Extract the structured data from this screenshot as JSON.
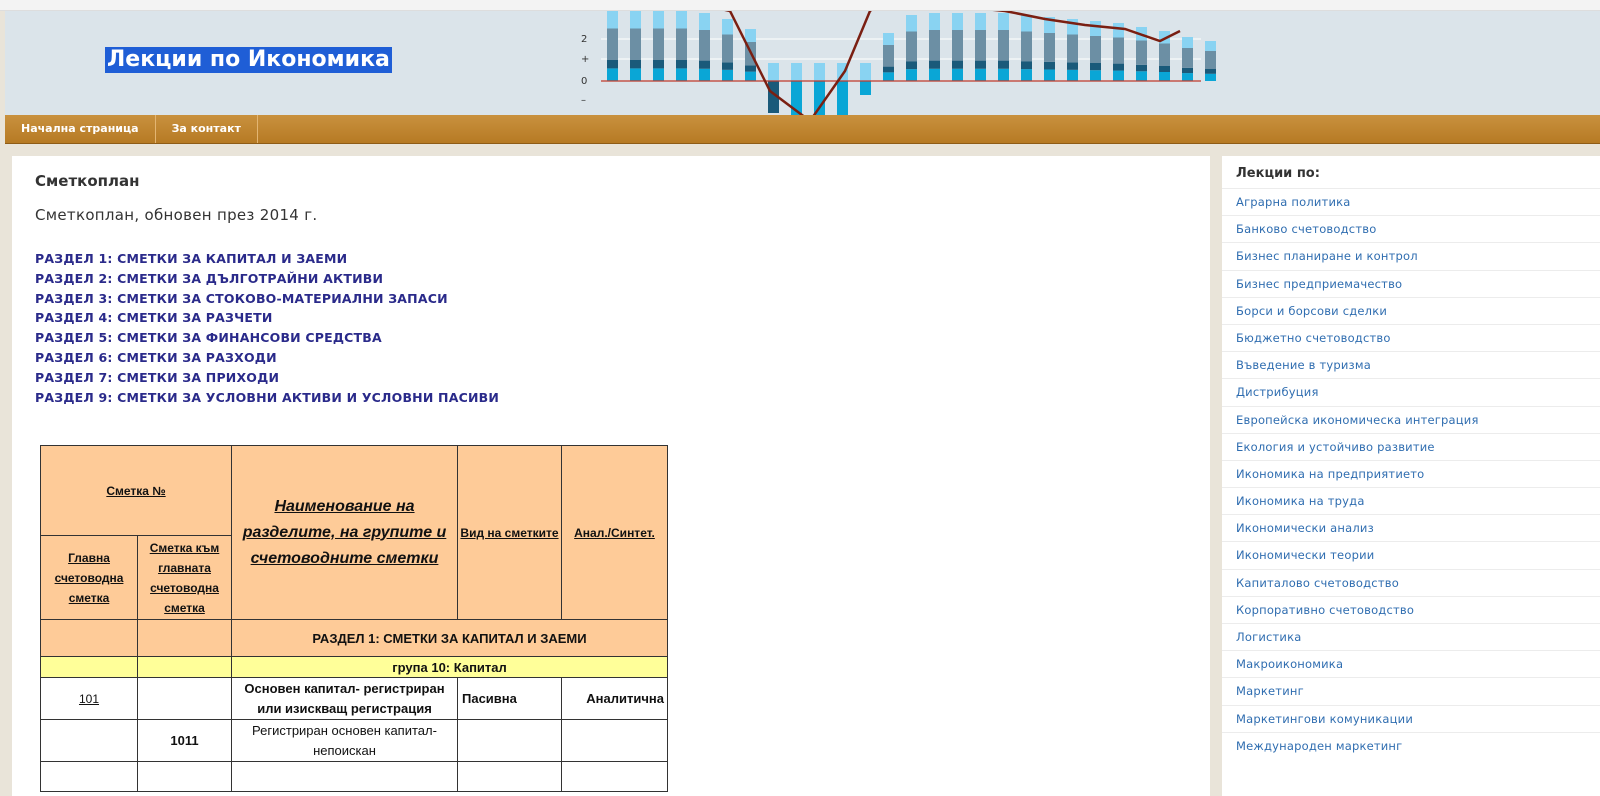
{
  "site": {
    "title": "Лекции по Икономика"
  },
  "header_chart": {
    "tick_labels": [
      "2",
      "+",
      "0",
      "–"
    ]
  },
  "nav": {
    "items": [
      "Начална страница",
      "За контакт"
    ]
  },
  "main": {
    "title": "Сметкоплан",
    "subtitle": "Сметкоплан, обновен през 2014 г.",
    "sections": [
      "РАЗДЕЛ 1: СМЕТКИ ЗА КАПИТАЛ И ЗАЕМИ",
      "РАЗДЕЛ 2: СМЕТКИ ЗА ДЪЛГОТРАЙНИ АКТИВИ",
      "РАЗДЕЛ 3: СМЕТКИ ЗА СТОКОВО-МАТЕРИАЛНИ ЗАПАСИ",
      "РАЗДЕЛ 4: СМЕТКИ ЗА РАЗЧЕТИ",
      "РАЗДЕЛ 5: СМЕТКИ ЗА ФИНАНСОВИ СРЕДСТВА",
      "РАЗДЕЛ 6: СМЕТКИ ЗА РАЗХОДИ",
      "РАЗДЕЛ 7: СМЕТКИ ЗА ПРИХОДИ",
      "РАЗДЕЛ 9: СМЕТКИ ЗА УСЛОВНИ АКТИВИ И УСЛОВНИ ПАСИВИ"
    ],
    "table": {
      "account_no": "Сметка №",
      "main_account": "Главна счетоводна сметка",
      "sub_account": "Сметка към главната счетоводна сметка",
      "name_header": "Наименование на разделите, на групите и счетоводните сметки",
      "type_header": "Вид на сметките",
      "anal_header": "Анал./Синтет.",
      "section_row": "РАЗДЕЛ 1: СМЕТКИ ЗА КАПИТАЛ И ЗАЕМИ",
      "group_row": "група 10: Капитал",
      "rows": [
        {
          "main": "101",
          "sub": "",
          "name": "Основен капитал- регистриран или изискващ регистрация",
          "type": "Пасивна",
          "anal": "Аналитична"
        },
        {
          "main": "",
          "sub": "1011",
          "name": "Регистриран основен капитал- непоискан",
          "type": "",
          "anal": ""
        }
      ]
    }
  },
  "sidebar": {
    "title": "Лекции по:",
    "items": [
      "Аграрна политика",
      "Банково счетоводство",
      "Бизнес планиране и контрол",
      "Бизнес предприемачество",
      "Борси и борсови сделки",
      "Бюджетно счетоводство",
      "Въведение в туризма",
      "Дистрибуция",
      "Европейска икономическа интеграция",
      "Екология и устойчиво развитие",
      "Икономика на предприятието",
      "Икономика на труда",
      "Икономически анализ",
      "Икономически теории",
      "Капиталово счетоводство",
      "Корпоративно счетоводство",
      "Логистика",
      "Макроикономика",
      "Маркетинг",
      "Маркетингови комуникации",
      "Международен маркетинг"
    ]
  }
}
